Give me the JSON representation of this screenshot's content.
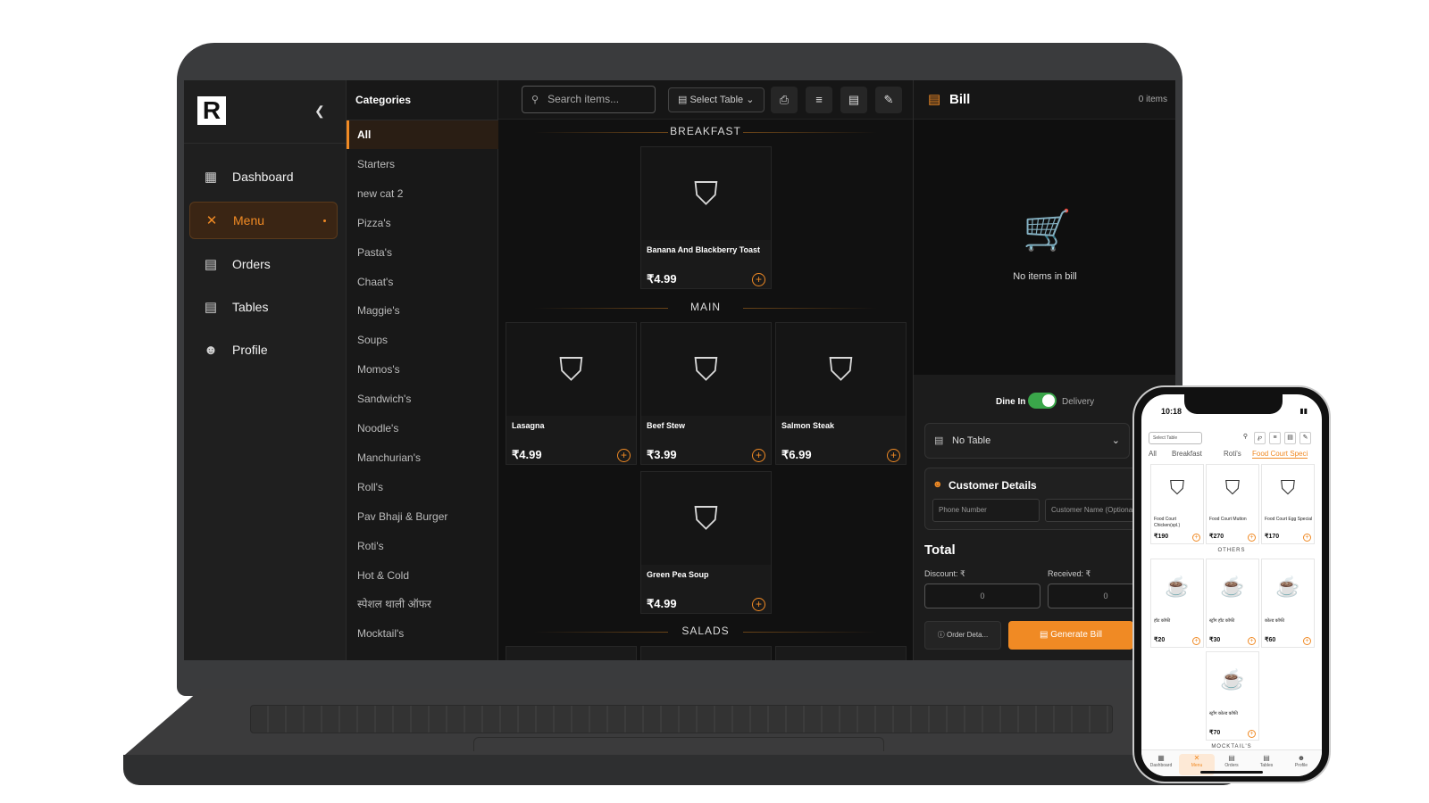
{
  "sidebar": {
    "logo": "R",
    "items": [
      {
        "label": "Dashboard",
        "icon": "dashboard-icon"
      },
      {
        "label": "Menu",
        "icon": "utensils-icon",
        "active": true
      },
      {
        "label": "Orders",
        "icon": "receipt-icon"
      },
      {
        "label": "Tables",
        "icon": "table-icon"
      },
      {
        "label": "Profile",
        "icon": "user-icon"
      }
    ]
  },
  "categories": {
    "title": "Categories",
    "items": [
      "All",
      "Starters",
      "new cat 2",
      "Pizza's",
      "Pasta's",
      "Chaat's",
      "Maggie's",
      "Soups",
      "Momos's",
      "Sandwich's",
      "Noodle's",
      "Manchurian's",
      "Roll's",
      "Pav Bhaji & Burger",
      "Roti's",
      "Hot & Cold",
      "स्पेशल थाली ऑफर",
      "Mocktail's"
    ],
    "active": "All"
  },
  "toolbar": {
    "search_placeholder": "Search items...",
    "select_table": "Select Table"
  },
  "menu": {
    "sections": [
      {
        "name": "BREAKFAST",
        "items": [
          {
            "name": "Banana And Blackberry Toast",
            "price": "₹4.99"
          }
        ]
      },
      {
        "name": "MAIN",
        "items": [
          {
            "name": "Lasagna",
            "price": "₹4.99"
          },
          {
            "name": "Beef Stew",
            "price": "₹3.99"
          },
          {
            "name": "Salmon Steak",
            "price": "₹6.99"
          },
          {
            "name": "Green Pea Soup",
            "price": "₹4.99"
          }
        ]
      },
      {
        "name": "SALADS",
        "items": []
      }
    ]
  },
  "bill": {
    "title": "Bill",
    "count": "0 items",
    "empty_text": "No items in bill",
    "dine_in": "Dine In",
    "delivery": "Delivery",
    "table": "No Table",
    "customer_title": "Customer Details",
    "phone_placeholder": "Phone Number",
    "name_placeholder": "Customer Name (Optional)",
    "total": "Total",
    "discount_label": "Discount: ₹",
    "received_label": "Received: ₹",
    "discount_value": "0",
    "received_value": "0",
    "order_details": "Order Deta...",
    "generate": "Generate Bill"
  },
  "phone": {
    "time": "10:18",
    "select_table": "Select Table",
    "tabs": [
      "All",
      "Breakfast",
      "Roti's",
      "Food Court Speci"
    ],
    "active_tab": "Food Court Speci",
    "top_items": [
      {
        "name": "Food Court Chicken(spl.)",
        "price": "₹190"
      },
      {
        "name": "Food Court Mutton",
        "price": "₹270"
      },
      {
        "name": "Food Court Egg Special",
        "price": "₹170"
      }
    ],
    "others_label": "OTHERS",
    "others": [
      {
        "name": "हॉट कॉफी",
        "price": "₹20"
      },
      {
        "name": "स्ट्रॉंग हॉट कॉफी",
        "price": "₹30"
      },
      {
        "name": "कोल्ड कॉफी",
        "price": "₹60"
      },
      {
        "name": "स्ट्रॉंग कोल्ड कॉफी",
        "price": "₹70"
      }
    ],
    "mocktails_label": "MOCKTAIL'S",
    "nav": [
      "Dashboard",
      "Menu",
      "Orders",
      "Tables",
      "Profile"
    ]
  },
  "colors": {
    "accent": "#f08a24",
    "bg": "#141414"
  }
}
